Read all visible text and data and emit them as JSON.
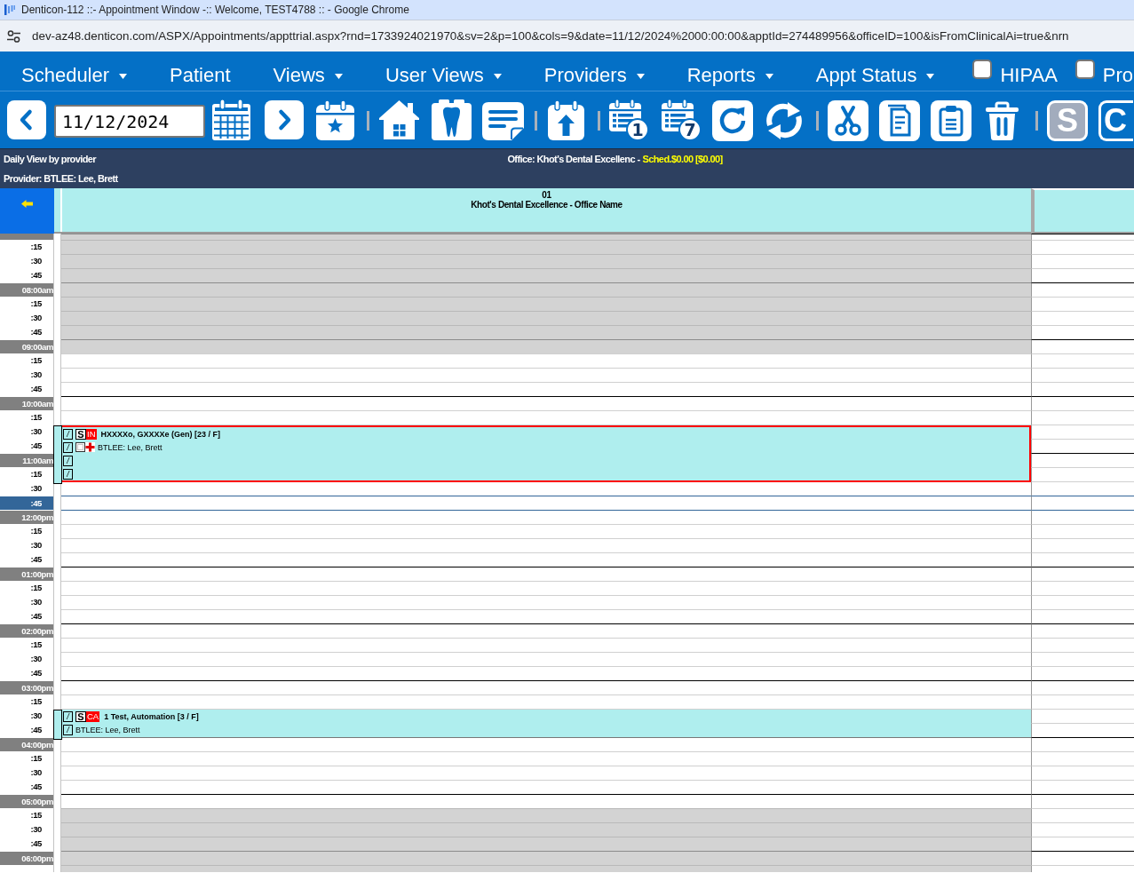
{
  "browser": {
    "title": "Denticon-112 ::- Appointment Window -:: Welcome, TEST4788 :: - Google Chrome",
    "url": "dev-az48.denticon.com/ASPX/Appointments/appttrial.aspx?rnd=1733924021970&sv=2&p=100&cols=9&date=11/12/2024%2000:00:00&apptId=274489956&officeID=100&isFromClinicalAi=true&nrn"
  },
  "menu": {
    "items": [
      {
        "label": "Scheduler",
        "dropdown": true
      },
      {
        "label": "Patient",
        "dropdown": false
      },
      {
        "label": "Views",
        "dropdown": true
      },
      {
        "label": "User Views",
        "dropdown": true
      },
      {
        "label": "Providers",
        "dropdown": true
      },
      {
        "label": "Reports",
        "dropdown": true
      },
      {
        "label": "Appt Status",
        "dropdown": true
      }
    ],
    "checkboxes": [
      {
        "label": "HIPAA",
        "checked": false
      },
      {
        "label": "Pro",
        "checked": false
      }
    ]
  },
  "toolbar": {
    "date": "11/12/2024",
    "day_badges": [
      "1",
      "7"
    ],
    "letter_buttons": [
      {
        "label": "S",
        "disabled": true
      },
      {
        "label": "C",
        "disabled": false
      }
    ]
  },
  "header": {
    "view_title": "Daily View by provider",
    "office": "Office: Khot's Dental Excellenc -",
    "schedule_total": "Sched.$0.00 [$0.00]",
    "provider": "Provider: BTLEE: Lee, Brett"
  },
  "schedule": {
    "column_number": "01",
    "column_title": "Khot's Dental Excellence - Office Name",
    "slots": [
      {
        "kind": "hour",
        "shaded": true,
        "selected": false
      },
      {
        "kind": "quarter",
        "label": ":15",
        "shaded": true,
        "selected": false
      },
      {
        "kind": "quarter",
        "label": ":30",
        "shaded": true,
        "selected": false
      },
      {
        "kind": "quarter",
        "label": ":45",
        "shaded": true,
        "selected": false
      },
      {
        "kind": "hour",
        "label": "08:00am",
        "shaded": true,
        "selected": false
      },
      {
        "kind": "quarter",
        "label": ":15",
        "shaded": true,
        "selected": false
      },
      {
        "kind": "quarter",
        "label": ":30",
        "shaded": true,
        "selected": false
      },
      {
        "kind": "quarter",
        "label": ":45",
        "shaded": true,
        "selected": false
      },
      {
        "kind": "hour",
        "label": "09:00am",
        "shaded": true,
        "selected": false
      },
      {
        "kind": "quarter",
        "label": ":15",
        "shaded": false,
        "selected": false
      },
      {
        "kind": "quarter",
        "label": ":30",
        "shaded": false,
        "selected": false
      },
      {
        "kind": "quarter",
        "label": ":45",
        "shaded": false,
        "selected": false
      },
      {
        "kind": "hour",
        "label": "10:00am",
        "shaded": false,
        "selected": false
      },
      {
        "kind": "quarter",
        "label": ":15",
        "shaded": false,
        "selected": false
      },
      {
        "kind": "quarter",
        "label": ":30",
        "selected": false,
        "appointment": {
          "selected": true,
          "lines": [
            {
              "mark": "/",
              "kind": "patient",
              "text": "HXXXXo, GXXXXe (Gen) [23 / F]",
              "badges": [
                {
                  "text": "S",
                  "kind": "outline"
                },
                {
                  "text": "IN",
                  "kind": "alert"
                }
              ]
            },
            {
              "mark": "/",
              "kind": "provider",
              "text": "BTLEE: Lee, Brett",
              "badges": [
                {
                  "kind": "note"
                },
                {
                  "kind": "medical"
                }
              ]
            },
            {
              "mark": "/"
            },
            {
              "mark": "/"
            }
          ]
        }
      },
      {
        "kind": "quarter",
        "label": ":45",
        "selected": false
      },
      {
        "kind": "hour",
        "label": "11:00am",
        "selected": false
      },
      {
        "kind": "quarter",
        "label": ":15",
        "selected": false
      },
      {
        "kind": "quarter",
        "label": ":30",
        "selected": false
      },
      {
        "kind": "quarter",
        "label": ":45",
        "shaded": false,
        "selected": true
      },
      {
        "kind": "hour",
        "label": "12:00pm",
        "shaded": false,
        "selected": false
      },
      {
        "kind": "quarter",
        "label": ":15",
        "shaded": false,
        "selected": false
      },
      {
        "kind": "quarter",
        "label": ":30",
        "shaded": false,
        "selected": false
      },
      {
        "kind": "quarter",
        "label": ":45",
        "shaded": false,
        "selected": false
      },
      {
        "kind": "hour",
        "label": "01:00pm",
        "shaded": false,
        "selected": false
      },
      {
        "kind": "quarter",
        "label": ":15",
        "shaded": false,
        "selected": false
      },
      {
        "kind": "quarter",
        "label": ":30",
        "shaded": false,
        "selected": false
      },
      {
        "kind": "quarter",
        "label": ":45",
        "shaded": false,
        "selected": false
      },
      {
        "kind": "hour",
        "label": "02:00pm",
        "shaded": false,
        "selected": false
      },
      {
        "kind": "quarter",
        "label": ":15",
        "shaded": false,
        "selected": false
      },
      {
        "kind": "quarter",
        "label": ":30",
        "shaded": false,
        "selected": false
      },
      {
        "kind": "quarter",
        "label": ":45",
        "shaded": false,
        "selected": false
      },
      {
        "kind": "hour",
        "label": "03:00pm",
        "shaded": false,
        "selected": false
      },
      {
        "kind": "quarter",
        "label": ":15",
        "shaded": false,
        "selected": false
      },
      {
        "kind": "quarter",
        "label": ":30",
        "selected": false,
        "appointment": {
          "selected": false,
          "lines": [
            {
              "mark": "/",
              "kind": "patient",
              "text": "1 Test, Automation [3 / F]",
              "badges": [
                {
                  "text": "S",
                  "kind": "outline"
                },
                {
                  "text": "CA",
                  "kind": "alert"
                }
              ]
            },
            {
              "mark": "/",
              "kind": "provider",
              "text": "BTLEE: Lee, Brett"
            }
          ]
        }
      },
      {
        "kind": "quarter",
        "label": ":45",
        "selected": false
      },
      {
        "kind": "hour",
        "label": "04:00pm",
        "selected": false
      },
      {
        "kind": "quarter",
        "label": ":15",
        "shaded": false,
        "selected": false
      },
      {
        "kind": "quarter",
        "label": ":30",
        "shaded": false,
        "selected": false
      },
      {
        "kind": "quarter",
        "label": ":45",
        "shaded": false,
        "selected": false
      },
      {
        "kind": "hour",
        "label": "05:00pm",
        "shaded": false,
        "selected": false
      },
      {
        "kind": "quarter",
        "label": ":15",
        "shaded": true,
        "selected": false
      },
      {
        "kind": "quarter",
        "label": ":30",
        "shaded": true,
        "selected": false
      },
      {
        "kind": "quarter",
        "label": ":45",
        "shaded": true,
        "selected": false
      },
      {
        "kind": "hour",
        "label": "06:00pm",
        "shaded": true,
        "selected": false
      },
      {
        "kind": "quarter",
        "shaded": true,
        "selected": false
      }
    ]
  }
}
